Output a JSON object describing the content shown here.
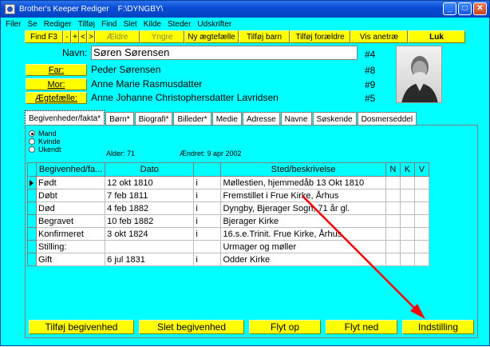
{
  "window": {
    "title": "Brother's Keeper Rediger    F:\\DYNGBY\\",
    "minimize": "_",
    "maximize": "□",
    "close": "✕"
  },
  "menu": [
    "Filer",
    "Se",
    "Rediger",
    "Tilføj",
    "Find",
    "Slet",
    "Kilde",
    "Steder",
    "Udskrifter"
  ],
  "toolbar": {
    "find": "Find  F3",
    "minus": "-",
    "plus": "+",
    "prev": "<",
    "next": ">",
    "older": "Ældre",
    "younger": "Yngre",
    "new_spouse": "Ny ægtefælle",
    "add_child": "Tilføj barn",
    "add_parents": "Tilføj forældre",
    "show_tree": "Vis anetræ",
    "close": "Luk"
  },
  "person": {
    "name_label": "Navn:",
    "name": "Søren Sørensen",
    "id": "#4"
  },
  "relations": [
    {
      "label": "Far:",
      "name": "Peder Sørensen",
      "id": "#8"
    },
    {
      "label": "Mor:",
      "name": "Anne Marie Rasmusdatter",
      "id": "#9"
    },
    {
      "label": "Ægtefælle:",
      "name": "Anne Johanne Christophersdatter Lavridsen",
      "id": "#5"
    }
  ],
  "tabs": [
    "Begivenheder/fakta*",
    "Børn*",
    "Biografi*",
    "Billeder*",
    "Medie",
    "Adresse",
    "Navne",
    "Søskende",
    "Dosmerseddel"
  ],
  "gender": {
    "options": [
      "Mand",
      "Kvinde",
      "Ukendt"
    ],
    "selected": "Mand"
  },
  "age": "Alder: 71",
  "changed": "Ændret: 9 apr 2002",
  "grid": {
    "headers": [
      "Begivenhed/fa...",
      "Dato",
      "",
      "Sted/beskrivelse",
      "N",
      "K",
      "V"
    ],
    "rows": [
      [
        "Født",
        "12 okt 1810",
        "i",
        "Møllestien, hjemmedåb 13 Okt 1810",
        "",
        "",
        ""
      ],
      [
        "Døbt",
        "7 feb 1811",
        "i",
        "Fremstillet i Frue Kirke, Århus",
        "",
        "",
        ""
      ],
      [
        "Død",
        "4 feb 1882",
        "i",
        "Dyngby, Bjerager Sogn, 71 år gl.",
        "",
        "",
        ""
      ],
      [
        "Begravet",
        "10 feb 1882",
        "i",
        "Bjerager Kirke",
        "",
        "",
        ""
      ],
      [
        "Konfirmeret",
        "3 okt 1824",
        "i",
        "16.s.e.Trinit. Frue Kirke, Århus",
        "",
        "",
        ""
      ],
      [
        "Stilling:",
        "",
        "",
        "Urmager og møller",
        "",
        "",
        ""
      ],
      [
        "Gift",
        "6 jul 1831",
        "i",
        "Odder Kirke",
        "",
        "",
        ""
      ]
    ]
  },
  "buttons": {
    "add_event": "Tilføj begivenhed",
    "delete_event": "Slet begivenhed",
    "move_up": "Flyt op",
    "move_down": "Flyt ned",
    "settings": "Indstilling"
  },
  "colors": {
    "background": "#00ffff",
    "button": "#ffff00",
    "arrow": "#ff0000"
  }
}
